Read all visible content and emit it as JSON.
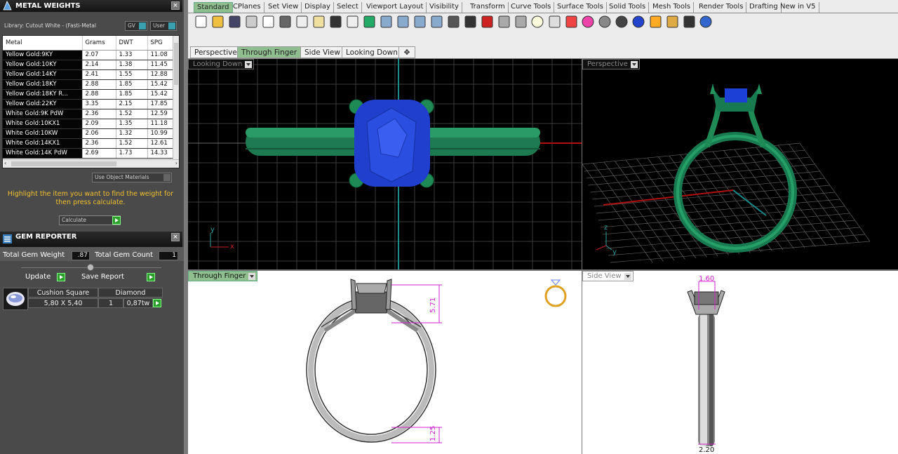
{
  "metal_weights": {
    "title": "METAL WEIGHTS",
    "library": "Library: Cutout White - (Fasti-Metal",
    "toggle_gv": "GV",
    "toggle_user": "User",
    "columns": [
      "Metal",
      "Grams",
      "DWT",
      "SPG"
    ],
    "rows": [
      [
        "Yellow Gold:9KY",
        "2.07",
        "1.33",
        "11.08"
      ],
      [
        "Yellow Gold:10KY",
        "2.14",
        "1.38",
        "11.45"
      ],
      [
        "Yellow Gold:14KY",
        "2.41",
        "1.55",
        "12.88"
      ],
      [
        "Yellow Gold:18KY",
        "2.88",
        "1.85",
        "15.42"
      ],
      [
        "Yellow Gold:18KY R...",
        "2.88",
        "1.85",
        "15.42"
      ],
      [
        "Yellow Gold:22KY",
        "3.35",
        "2.15",
        "17.85"
      ],
      [
        "White Gold:9K PdW",
        "2.36",
        "1.52",
        "12.59"
      ],
      [
        "White Gold:10KX1",
        "2.09",
        "1.35",
        "11.18"
      ],
      [
        "White Gold:10KW",
        "2.06",
        "1.32",
        "10.99"
      ],
      [
        "White Gold:14KX1",
        "2.36",
        "1.52",
        "12.61"
      ],
      [
        "White Gold:14K PdW",
        "2.69",
        "1.73",
        "14.33"
      ]
    ],
    "use_object_materials": "Use Object Materials",
    "hint": "Highlight the item you want to find the weight for then press calculate.",
    "calculate_label": "Calculate"
  },
  "gem_reporter": {
    "title": "GEM REPORTER",
    "total_weight_label": "Total Gem Weight",
    "total_weight_value": ".87",
    "total_count_label": "Total Gem Count",
    "total_count_value": "1",
    "update_label": "Update",
    "save_report_label": "Save Report",
    "gem": {
      "shape": "Cushion Square",
      "type": "Diamond",
      "size": "5,80 X 5,40",
      "count": "1",
      "weight": "0,87tw"
    }
  },
  "toolbar_tabs": [
    "Standard",
    "CPlanes",
    "Set View",
    "Display",
    "Select",
    "Viewport Layout",
    "Visibility",
    "Transform",
    "Curve Tools",
    "Surface Tools",
    "Solid Tools",
    "Mesh Tools",
    "Render Tools",
    "Drafting",
    "New in V5"
  ],
  "active_toolbar_tab": "Standard",
  "viewport_tabs": [
    "Perspective",
    "Through Finger",
    "Side View",
    "Looking Down"
  ],
  "viewport_add_glyph": "✥",
  "viewports": {
    "top_left": "Looking Down",
    "top_right": "Perspective",
    "bottom_left": "Through Finger",
    "bottom_right": "Side View"
  },
  "axis_labels": {
    "x": "x",
    "y": "y",
    "z": "z"
  },
  "dimensions": {
    "through_finger_height": "5.71",
    "through_finger_band": "1.25",
    "side_top": "1.60",
    "side_bottom": "2.20"
  },
  "colors": {
    "accent_green": "#2a8a5a",
    "gem_blue": "#1c3fd6",
    "dimension_magenta": "#d020d0"
  }
}
